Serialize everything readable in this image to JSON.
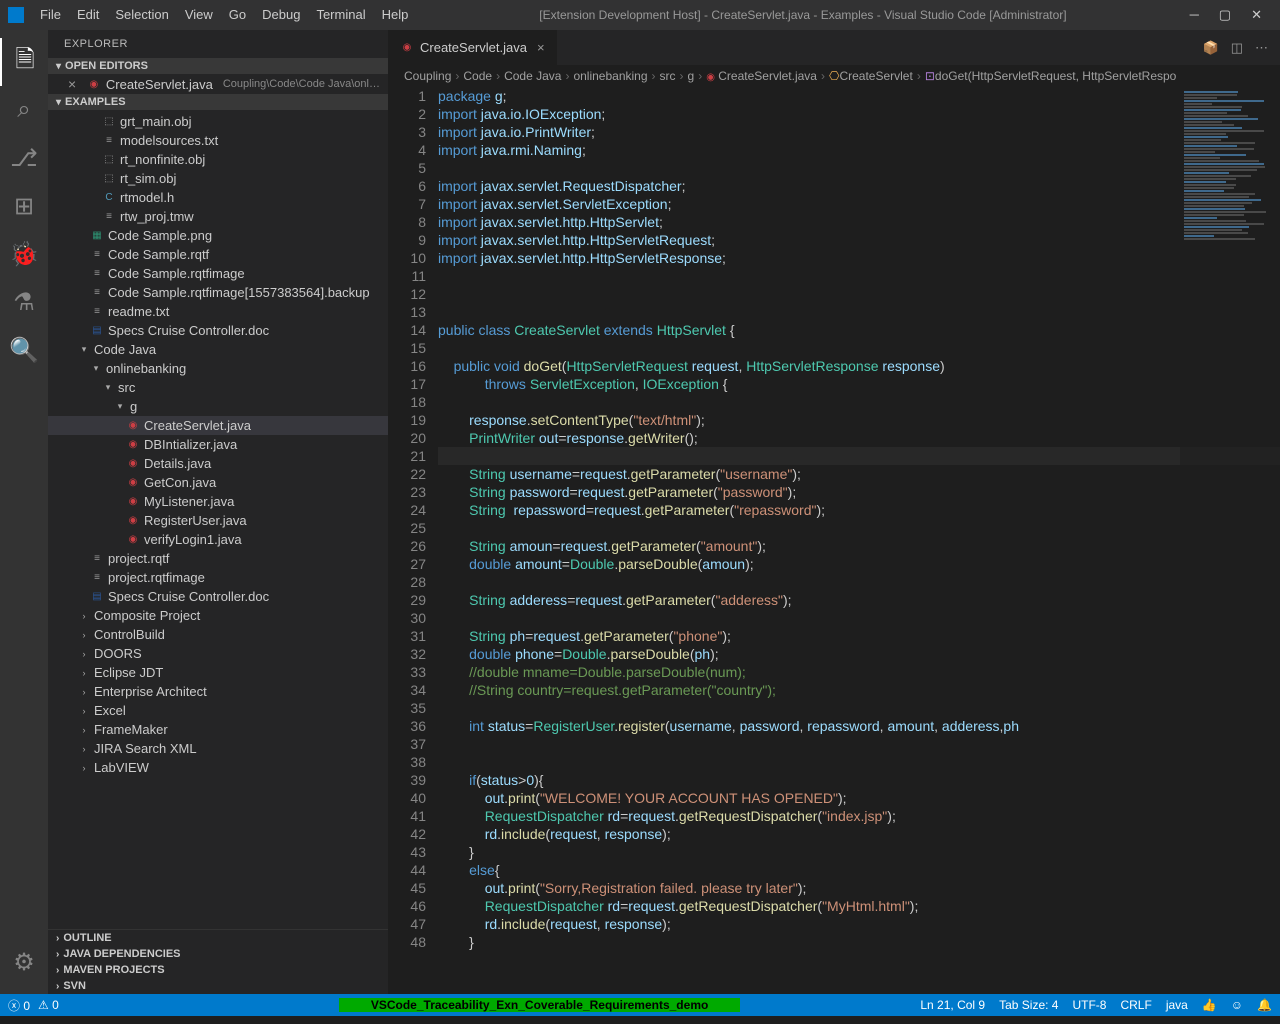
{
  "window": {
    "title": "[Extension Development Host] - CreateServlet.java - Examples - Visual Studio Code [Administrator]"
  },
  "menu": [
    "File",
    "Edit",
    "Selection",
    "View",
    "Go",
    "Debug",
    "Terminal",
    "Help"
  ],
  "explorer": {
    "title": "EXPLORER",
    "openEditors": {
      "label": "OPEN EDITORS",
      "items": [
        {
          "name": "CreateServlet.java",
          "path": "Coupling\\Code\\Code Java\\onlineba..."
        }
      ]
    },
    "workspace": "EXAMPLES",
    "tree": [
      {
        "type": "file",
        "icon": "obj",
        "name": "grt_main.obj",
        "depth": 2
      },
      {
        "type": "file",
        "icon": "txt",
        "name": "modelsources.txt",
        "depth": 2
      },
      {
        "type": "file",
        "icon": "obj",
        "name": "rt_nonfinite.obj",
        "depth": 2
      },
      {
        "type": "file",
        "icon": "obj",
        "name": "rt_sim.obj",
        "depth": 2
      },
      {
        "type": "file",
        "icon": "c",
        "name": "rtmodel.h",
        "depth": 2
      },
      {
        "type": "file",
        "icon": "txt",
        "name": "rtw_proj.tmw",
        "depth": 2
      },
      {
        "type": "file",
        "icon": "img",
        "name": "Code Sample.png",
        "depth": 1
      },
      {
        "type": "file",
        "icon": "txt",
        "name": "Code Sample.rqtf",
        "depth": 1
      },
      {
        "type": "file",
        "icon": "txt",
        "name": "Code Sample.rqtfimage",
        "depth": 1
      },
      {
        "type": "file",
        "icon": "txt",
        "name": "Code Sample.rqtfimage[1557383564].backup",
        "depth": 1
      },
      {
        "type": "file",
        "icon": "txt",
        "name": "readme.txt",
        "depth": 1
      },
      {
        "type": "file",
        "icon": "doc",
        "name": "Specs Cruise Controller.doc",
        "depth": 1
      },
      {
        "type": "folder",
        "open": true,
        "name": "Code Java",
        "depth": 0
      },
      {
        "type": "folder",
        "open": true,
        "name": "onlinebanking",
        "depth": 1
      },
      {
        "type": "folder",
        "open": true,
        "name": "src",
        "depth": 2
      },
      {
        "type": "folder",
        "open": true,
        "name": "g",
        "depth": 3
      },
      {
        "type": "file",
        "icon": "java",
        "name": "CreateServlet.java",
        "depth": 4,
        "selected": true
      },
      {
        "type": "file",
        "icon": "java",
        "name": "DBIntializer.java",
        "depth": 4
      },
      {
        "type": "file",
        "icon": "java",
        "name": "Details.java",
        "depth": 4
      },
      {
        "type": "file",
        "icon": "java",
        "name": "GetCon.java",
        "depth": 4
      },
      {
        "type": "file",
        "icon": "java",
        "name": "MyListener.java",
        "depth": 4
      },
      {
        "type": "file",
        "icon": "java",
        "name": "RegisterUser.java",
        "depth": 4
      },
      {
        "type": "file",
        "icon": "java",
        "name": "verifyLogin1.java",
        "depth": 4
      },
      {
        "type": "file",
        "icon": "txt",
        "name": "project.rqtf",
        "depth": 1
      },
      {
        "type": "file",
        "icon": "txt",
        "name": "project.rqtfimage",
        "depth": 1
      },
      {
        "type": "file",
        "icon": "doc",
        "name": "Specs Cruise Controller.doc",
        "depth": 1
      },
      {
        "type": "folder",
        "open": false,
        "name": "Composite Project",
        "depth": 0
      },
      {
        "type": "folder",
        "open": false,
        "name": "ControlBuild",
        "depth": 0
      },
      {
        "type": "folder",
        "open": false,
        "name": "DOORS",
        "depth": 0
      },
      {
        "type": "folder",
        "open": false,
        "name": "Eclipse JDT",
        "depth": 0
      },
      {
        "type": "folder",
        "open": false,
        "name": "Enterprise Architect",
        "depth": 0
      },
      {
        "type": "folder",
        "open": false,
        "name": "Excel",
        "depth": 0
      },
      {
        "type": "folder",
        "open": false,
        "name": "FrameMaker",
        "depth": 0
      },
      {
        "type": "folder",
        "open": false,
        "name": "JIRA Search XML",
        "depth": 0
      },
      {
        "type": "folder",
        "open": false,
        "name": "LabVIEW",
        "depth": 0
      }
    ],
    "sections": [
      "OUTLINE",
      "JAVA DEPENDENCIES",
      "MAVEN PROJECTS",
      "SVN"
    ]
  },
  "tabs": [
    {
      "name": "CreateServlet.java",
      "icon": "java",
      "active": true
    }
  ],
  "breadcrumb": [
    "Coupling",
    "Code",
    "Code Java",
    "onlinebanking",
    "src",
    "g",
    "CreateServlet.java",
    "CreateServlet",
    "doGet(HttpServletRequest, HttpServletRespo"
  ],
  "code": {
    "lines": [
      {
        "n": 1,
        "html": "<span class='kw'>package</span> <span class='pkg'>g</span>;"
      },
      {
        "n": 2,
        "html": "<span class='kw'>import</span> <span class='pkg'>java.io.IOException</span>;"
      },
      {
        "n": 3,
        "html": "<span class='kw'>import</span> <span class='pkg'>java.io.PrintWriter</span>;"
      },
      {
        "n": 4,
        "html": "<span class='kw'>import</span> <span class='pkg'>java.rmi.Naming</span>;"
      },
      {
        "n": 5,
        "html": ""
      },
      {
        "n": 6,
        "html": "<span class='kw'>import</span> <span class='pkg'>javax.servlet.RequestDispatcher</span>;"
      },
      {
        "n": 7,
        "html": "<span class='kw'>import</span> <span class='pkg'>javax.servlet.ServletException</span>;"
      },
      {
        "n": 8,
        "html": "<span class='kw'>import</span> <span class='pkg'>javax.servlet.http.HttpServlet</span>;"
      },
      {
        "n": 9,
        "html": "<span class='kw'>import</span> <span class='pkg'>javax.servlet.http.HttpServletRequest</span>;"
      },
      {
        "n": 10,
        "html": "<span class='kw'>import</span> <span class='pkg'>javax.servlet.http.HttpServletResponse</span>;"
      },
      {
        "n": 11,
        "html": ""
      },
      {
        "n": 12,
        "html": ""
      },
      {
        "n": 13,
        "html": ""
      },
      {
        "n": 14,
        "html": "<span class='kw'>public</span> <span class='kw'>class</span> <span class='cls'>CreateServlet</span> <span class='kw'>extends</span> <span class='cls'>HttpServlet</span> {"
      },
      {
        "n": 15,
        "html": ""
      },
      {
        "n": 16,
        "html": "    <span class='kw'>public</span> <span class='kw'>void</span> <span class='fn'>doGet</span>(<span class='cls'>HttpServletRequest</span> <span class='var'>request</span>, <span class='cls'>HttpServletResponse</span> <span class='var'>response</span>)"
      },
      {
        "n": 17,
        "html": "            <span class='kw'>throws</span> <span class='cls'>ServletException</span>, <span class='cls'>IOException</span> {"
      },
      {
        "n": 18,
        "html": ""
      },
      {
        "n": 19,
        "html": "        <span class='var'>response</span>.<span class='fn'>setContentType</span>(<span class='str'>\"text/html\"</span>);"
      },
      {
        "n": 20,
        "html": "        <span class='cls'>PrintWriter</span> <span class='var'>out</span>=<span class='var'>response</span>.<span class='fn'>getWriter</span>();"
      },
      {
        "n": 21,
        "html": "        ",
        "current": true
      },
      {
        "n": 22,
        "html": "        <span class='cls'>String</span> <span class='var'>username</span>=<span class='var'>request</span>.<span class='fn'>getParameter</span>(<span class='str'>\"username\"</span>);"
      },
      {
        "n": 23,
        "html": "        <span class='cls'>String</span> <span class='var'>password</span>=<span class='var'>request</span>.<span class='fn'>getParameter</span>(<span class='str'>\"password\"</span>);"
      },
      {
        "n": 24,
        "html": "        <span class='cls'>String</span>  <span class='var'>repassword</span>=<span class='var'>request</span>.<span class='fn'>getParameter</span>(<span class='str'>\"repassword\"</span>);"
      },
      {
        "n": 25,
        "html": ""
      },
      {
        "n": 26,
        "html": "        <span class='cls'>String</span> <span class='var'>amoun</span>=<span class='var'>request</span>.<span class='fn'>getParameter</span>(<span class='str'>\"amount\"</span>);"
      },
      {
        "n": 27,
        "html": "        <span class='kw'>double</span> <span class='var'>amount</span>=<span class='cls'>Double</span>.<span class='fn'>parseDouble</span>(<span class='var'>amoun</span>);"
      },
      {
        "n": 28,
        "html": ""
      },
      {
        "n": 29,
        "html": "        <span class='cls'>String</span> <span class='var'>adderess</span>=<span class='var'>request</span>.<span class='fn'>getParameter</span>(<span class='str'>\"adderess\"</span>);"
      },
      {
        "n": 30,
        "html": ""
      },
      {
        "n": 31,
        "html": "        <span class='cls'>String</span> <span class='var'>ph</span>=<span class='var'>request</span>.<span class='fn'>getParameter</span>(<span class='str'>\"phone\"</span>);"
      },
      {
        "n": 32,
        "html": "        <span class='kw'>double</span> <span class='var'>phone</span>=<span class='cls'>Double</span>.<span class='fn'>parseDouble</span>(<span class='var'>ph</span>);"
      },
      {
        "n": 33,
        "html": "        <span class='cmt'>//double mname=Double.parseDouble(num);</span>"
      },
      {
        "n": 34,
        "html": "        <span class='cmt'>//String country=request.getParameter(\"country\");</span>"
      },
      {
        "n": 35,
        "html": ""
      },
      {
        "n": 36,
        "html": "        <span class='kw'>int</span> <span class='var'>status</span>=<span class='cls'>RegisterUser</span>.<span class='fn'>register</span>(<span class='var'>username</span>, <span class='var'>password</span>, <span class='var'>repassword</span>, <span class='var'>amount</span>, <span class='var'>adderess</span>,<span class='var'>ph</span>"
      },
      {
        "n": 37,
        "html": ""
      },
      {
        "n": 38,
        "html": ""
      },
      {
        "n": 39,
        "html": "        <span class='kw'>if</span>(<span class='var'>status</span>><span class='var'>0</span>){"
      },
      {
        "n": 40,
        "html": "            <span class='var'>out</span>.<span class='fn'>print</span>(<span class='str'>\"WELCOME! YOUR ACCOUNT HAS OPENED\"</span>);"
      },
      {
        "n": 41,
        "html": "            <span class='cls'>RequestDispatcher</span> <span class='var'>rd</span>=<span class='var'>request</span>.<span class='fn'>getRequestDispatcher</span>(<span class='str'>\"index.jsp\"</span>);"
      },
      {
        "n": 42,
        "html": "            <span class='var'>rd</span>.<span class='fn'>include</span>(<span class='var'>request</span>, <span class='var'>response</span>);"
      },
      {
        "n": 43,
        "html": "        }"
      },
      {
        "n": 44,
        "html": "        <span class='kw'>else</span>{"
      },
      {
        "n": 45,
        "html": "            <span class='var'>out</span>.<span class='fn'>print</span>(<span class='str'>\"Sorry,Registration failed. please try later\"</span>);"
      },
      {
        "n": 46,
        "html": "            <span class='cls'>RequestDispatcher</span> <span class='var'>rd</span>=<span class='var'>request</span>.<span class='fn'>getRequestDispatcher</span>(<span class='str'>\"MyHtml.html\"</span>);"
      },
      {
        "n": 47,
        "html": "            <span class='var'>rd</span>.<span class='fn'>include</span>(<span class='var'>request</span>, <span class='var'>response</span>);"
      },
      {
        "n": 48,
        "html": "        }"
      }
    ]
  },
  "status": {
    "errors": "0",
    "warnings": "0",
    "center": "VSCode_Traceability_Exn_Coverable_Requirements_demo",
    "position": "Ln 21, Col 9",
    "tabSize": "Tab Size: 4",
    "encoding": "UTF-8",
    "eol": "CRLF",
    "lang": "java",
    "feedback": "☺"
  }
}
